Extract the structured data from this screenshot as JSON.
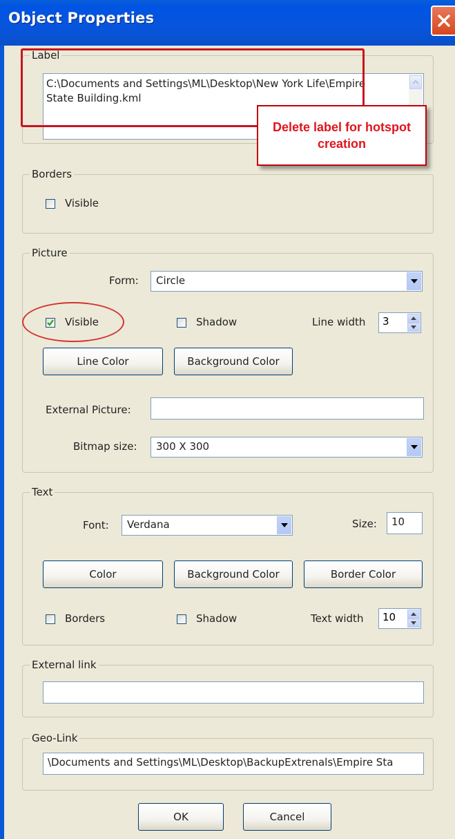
{
  "window": {
    "title": "Object Properties"
  },
  "label_group": {
    "legend": "Label",
    "text": "C:\\Documents and Settings\\ML\\Desktop\\New York Life\\Empire State Building.kml"
  },
  "callout": {
    "text": "Delete label for hotspot creation"
  },
  "borders_group": {
    "legend": "Borders",
    "visible_label": "Visible",
    "visible_checked": false
  },
  "picture_group": {
    "legend": "Picture",
    "form_label": "Form:",
    "form_value": "Circle",
    "visible_label": "Visible",
    "visible_checked": true,
    "shadow_label": "Shadow",
    "shadow_checked": false,
    "line_width_label": "Line width",
    "line_width_value": "3",
    "line_color_button": "Line Color",
    "background_color_button": "Background Color",
    "external_picture_label": "External Picture:",
    "external_picture_value": "",
    "bitmap_size_label": "Bitmap size:",
    "bitmap_size_value": "300 X 300"
  },
  "text_group": {
    "legend": "Text",
    "font_label": "Font:",
    "font_value": "Verdana",
    "size_label": "Size:",
    "size_value": "10",
    "color_button": "Color",
    "background_color_button": "Background Color",
    "border_color_button": "Border Color",
    "borders_label": "Borders",
    "borders_checked": false,
    "shadow_label": "Shadow",
    "shadow_checked": false,
    "text_width_label": "Text width",
    "text_width_value": "10"
  },
  "external_link_group": {
    "legend": "External link",
    "value": ""
  },
  "geo_link_group": {
    "legend": "Geo-Link",
    "value": "\\Documents and Settings\\ML\\Desktop\\BackupExtrenals\\Empire Sta"
  },
  "footer": {
    "ok_button": "OK",
    "cancel_button": "Cancel"
  },
  "colors": {
    "title_bar": "#0054e3",
    "dialog_bg": "#ece9d8",
    "annotation_red": "#c8141e"
  }
}
